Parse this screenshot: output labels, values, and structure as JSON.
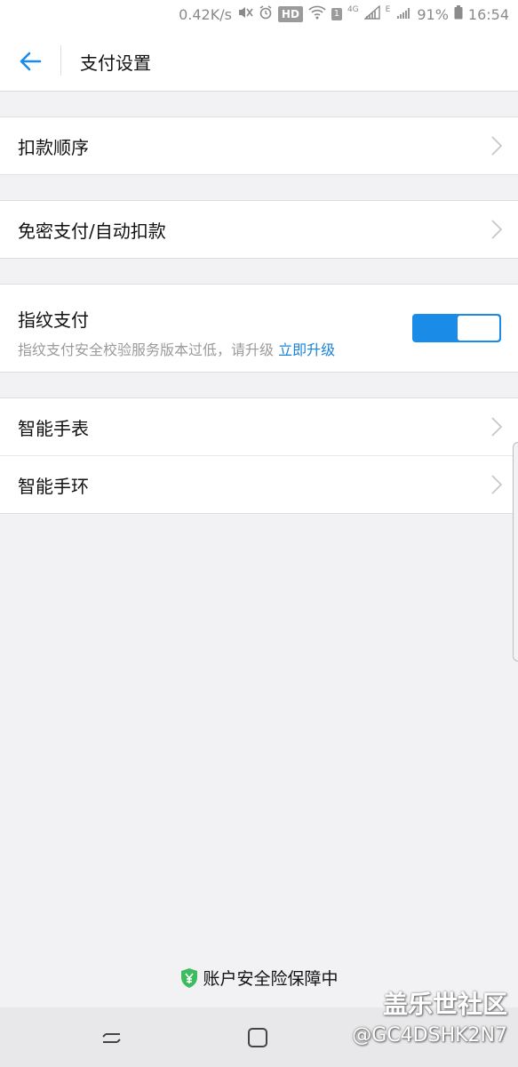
{
  "status_bar": {
    "speed": "0.42K/s",
    "hd": "HD",
    "sim": "1",
    "net_4g": "4G",
    "net_e": "E",
    "battery": "91%",
    "time": "16:54"
  },
  "nav": {
    "back_icon": "arrow-left-icon",
    "title": "支付设置"
  },
  "groups": {
    "deduction_order": "扣款顺序",
    "password_free": "免密支付/自动扣款",
    "fingerprint": {
      "title": "指纹支付",
      "subtitle": "指纹支付安全校验服务版本过低，请升级",
      "link": "立即升级",
      "toggle_on": true
    },
    "smart_watch": "智能手表",
    "smart_band": "智能手环"
  },
  "footer": {
    "security_text": "账户安全险保障中",
    "shield_icon": "shield-yuan-icon"
  },
  "watermark": {
    "line1": "盖乐世社区",
    "line2": "@GC4DSHK2N7"
  },
  "colors": {
    "accent": "#1a8ce8",
    "link": "#1a83d8",
    "shield_green": "#3dbb5e",
    "background": "#f2f2f4"
  }
}
